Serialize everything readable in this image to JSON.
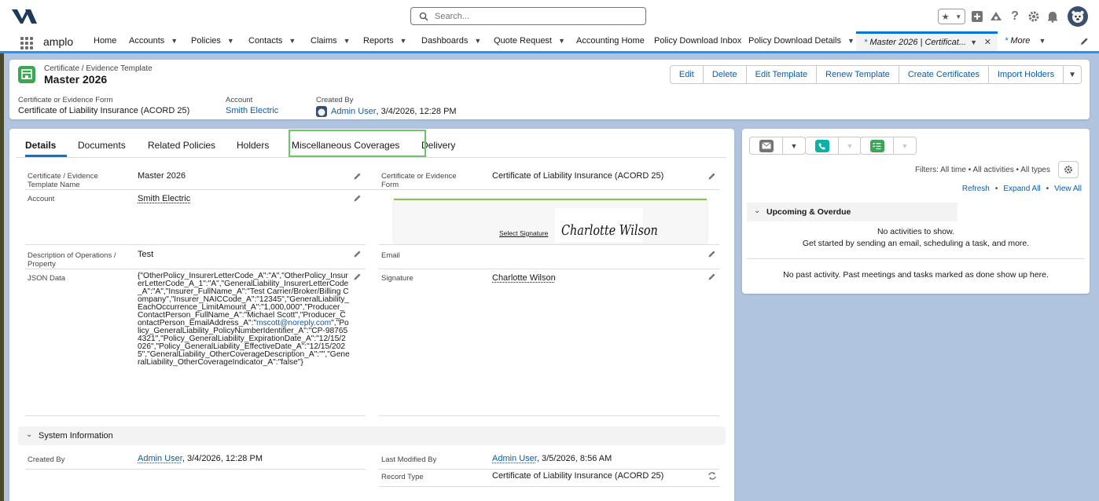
{
  "topbar": {
    "search_placeholder": "Search...",
    "icons": [
      "star-icon",
      "chevron-down-icon",
      "add-icon",
      "trailhead-icon",
      "help-icon",
      "gear-icon",
      "bell-icon",
      "avatar-icon"
    ]
  },
  "nav": {
    "app_name": "amplo",
    "items": [
      {
        "label": "Home",
        "chevron": false
      },
      {
        "label": "Accounts",
        "chevron": true
      },
      {
        "label": "Policies",
        "chevron": true
      },
      {
        "label": "Contacts",
        "chevron": true
      },
      {
        "label": "Claims",
        "chevron": true
      },
      {
        "label": "Reports",
        "chevron": true
      },
      {
        "label": "Dashboards",
        "chevron": true
      },
      {
        "label": "Quote Request",
        "chevron": true
      },
      {
        "label": "Accounting Home",
        "chevron": false
      },
      {
        "label": "Policy Download Inbox",
        "chevron": false
      },
      {
        "label": "Policy Download Details",
        "chevron": true
      }
    ],
    "active_tab": {
      "dirty_marker": "*",
      "label": "Master 2026 | Certificat..."
    },
    "more": {
      "dirty_marker": "*",
      "label": "More"
    }
  },
  "record": {
    "object_type": "Certificate / Evidence Template",
    "name": "Master 2026",
    "actions": [
      "Edit",
      "Delete",
      "Edit Template",
      "Renew Template",
      "Create Certificates",
      "Import Holders"
    ],
    "highlights": {
      "form_label": "Certificate or Evidence Form",
      "form_value": "Certificate of Liability Insurance (ACORD 25)",
      "account_label": "Account",
      "account_value": "Smith Electric",
      "created_by_label": "Created By",
      "created_by_user": "Admin User",
      "created_by_date": ", 3/4/2026, 12:28 PM"
    }
  },
  "tabs": [
    "Details",
    "Documents",
    "Related Policies",
    "Holders",
    "Miscellaneous Coverages",
    "Delivery"
  ],
  "details": {
    "template_name_label": "Certificate / Evidence Template Name",
    "template_name_value": "Master 2026",
    "form_label": "Certificate or Evidence Form",
    "form_value": "Certificate of Liability Insurance (ACORD 25)",
    "account_label": "Account",
    "account_value": "Smith Electric",
    "select_signature": "Select Signature",
    "signature_script": "Charlotte Wilson",
    "description_label": "Description of Operations / Property",
    "description_value": "Test",
    "email_label": "Email",
    "json_label": "JSON Data",
    "json_part1": "{\"OtherPolicy_InsurerLetterCode_A\":\"A\",\"OtherPolicy_InsurerLetterCode_A_1\":\"A\",\"GeneralLiability_InsurerLetterCode_A\":\"A\",\"Insurer_FullName_A\":\"Test Carrier/Broker/Billing Company\",\"Insurer_NAICCode_A\":\"12345\",\"GeneralLiability_EachOccurrence_LimitAmount_A\":\"1,000,000\",\"Producer_ContactPerson_FullName_A\":\"Michael Scott\",\"Producer_ContactPerson_EmailAddress_A\":\"",
    "json_email": "mscott@noreply.com",
    "json_part2": "\",\"Policy_GeneralLiability_PolicyNumberIdentifier_A\":\"CP-987654321\",\"Policy_GeneralLiability_ExpirationDate_A\":\"12/15/2026\",\"Policy_GeneralLiability_EffectiveDate_A\":\"12/15/2025\",\"GeneralLiability_OtherCoverageDescription_A\":\"\",\"GeneralLiability_OtherCoverageIndicator_A\":\"false\"}",
    "signature_label": "Signature",
    "signature_value": "Charlotte Wilson"
  },
  "system_info": {
    "title": "System Information",
    "created_by_label": "Created By",
    "created_by_user": "Admin User",
    "created_by_date": ", 3/4/2026, 12:28 PM",
    "modified_label": "Last Modified By",
    "modified_user": "Admin User",
    "modified_date": ", 3/5/2026, 8:56 AM",
    "record_type_label": "Record Type",
    "record_type_value": "Certificate of Liability Insurance (ACORD 25)"
  },
  "activity": {
    "filters": "Filters: All time • All activities • All types",
    "refresh": "Refresh",
    "expand_all": "Expand All",
    "view_all": "View All",
    "upcoming_title": "Upcoming & Overdue",
    "no_activities": "No activities to show.",
    "get_started": "Get started by sending an email, scheduling a task, and more.",
    "no_past": "No past activity. Past meetings and tasks marked as done show up here."
  }
}
